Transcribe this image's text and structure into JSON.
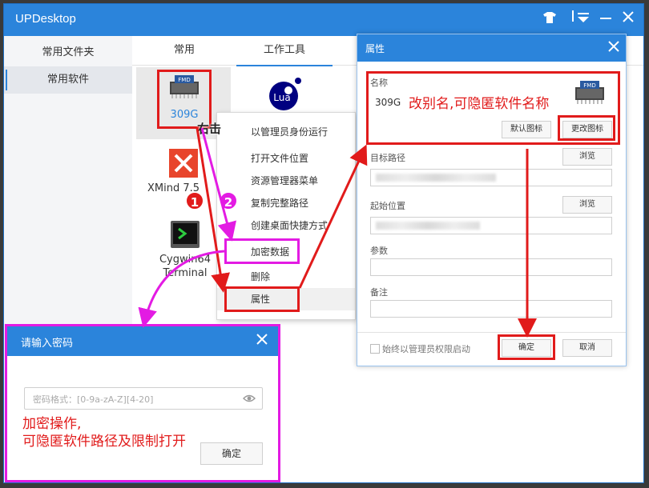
{
  "app": {
    "title": "UPDesktop"
  },
  "sidebar": {
    "items": [
      {
        "label": "常用文件夹"
      },
      {
        "label": "常用软件"
      }
    ]
  },
  "tabs": [
    {
      "label": "常用"
    },
    {
      "label": "工作工具"
    }
  ],
  "apps": [
    {
      "label": "309G",
      "icon": "fmd-chip-icon"
    },
    {
      "label": "XMind 7.5",
      "icon": "xmind-icon"
    },
    {
      "label": "Cygwin64 Terminal",
      "label_line1": "Cygwin64",
      "label_line2": "Terminal",
      "icon": "cygwin-icon"
    },
    {
      "label": "Lua",
      "icon": "lua-icon"
    }
  ],
  "context_menu": {
    "items": [
      "以管理员身份运行",
      "打开文件位置",
      "资源管理器菜单",
      "复制完整路径",
      "创建桌面快捷方式",
      "加密数据",
      "删除",
      "属性"
    ]
  },
  "properties": {
    "title": "属性",
    "name_label": "名称",
    "name_value": "309G",
    "default_icon": "默认图标",
    "change_icon": "更改图标",
    "target_label": "目标路径",
    "start_label": "起始位置",
    "browse": "浏览",
    "args_label": "参数",
    "note_label": "备注",
    "admin_checkbox": "始终以管理员权限启动",
    "ok": "确定",
    "cancel": "取消"
  },
  "password_dialog": {
    "title": "请输入密码",
    "placeholder": "密码格式：[0-9a-zA-Z][4-20]",
    "ok": "确定"
  },
  "annotations": {
    "right_click": "右击",
    "rename_note": "改别名,可隐匿软件名称",
    "encrypt_note_line1": "加密操作,",
    "encrypt_note_line2": "可隐匿软件路径及限制打开",
    "step1": "1",
    "step2": "2"
  },
  "colors": {
    "accent": "#2b84db",
    "annotation_red": "#e11b1b",
    "annotation_magenta": "#e31be3"
  }
}
